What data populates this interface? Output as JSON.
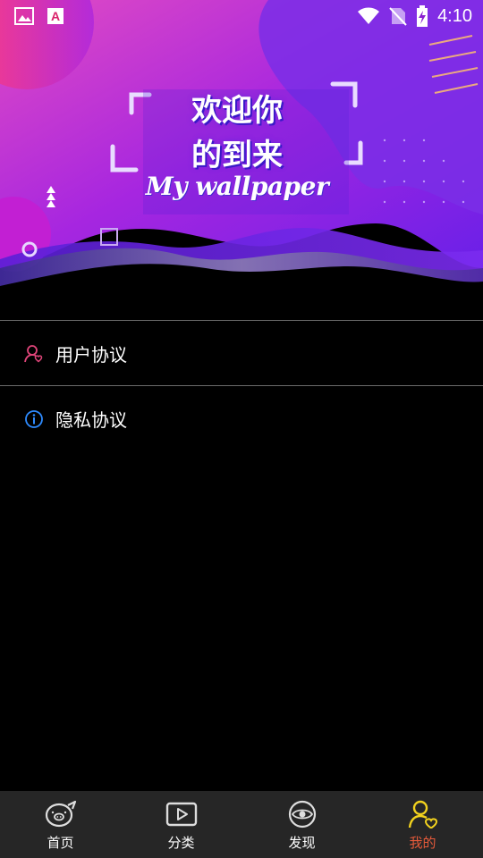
{
  "status_bar": {
    "time": "4:10",
    "icons": [
      "gallery-icon",
      "font-a-icon",
      "wifi-icon",
      "no-sim-icon",
      "battery-charging-icon"
    ]
  },
  "banner": {
    "welcome_line1": "欢迎你",
    "welcome_line2": "的到来",
    "script_text": "My wallpaper"
  },
  "menu": {
    "items": [
      {
        "label": "用户协议",
        "icon": "user-agreement-icon",
        "icon_color": "#e0457a"
      },
      {
        "label": "隐私协议",
        "icon": "info-icon",
        "icon_color": "#2e8bff"
      }
    ]
  },
  "bottom_nav": {
    "items": [
      {
        "label": "首页",
        "icon": "pig-home-icon",
        "active": false
      },
      {
        "label": "分类",
        "icon": "play-category-icon",
        "active": false
      },
      {
        "label": "发现",
        "icon": "eye-discover-icon",
        "active": false
      },
      {
        "label": "我的",
        "icon": "profile-heart-icon",
        "active": true
      }
    ],
    "active_color": "#e55a3a",
    "active_icon_color": "#f2d21e"
  }
}
